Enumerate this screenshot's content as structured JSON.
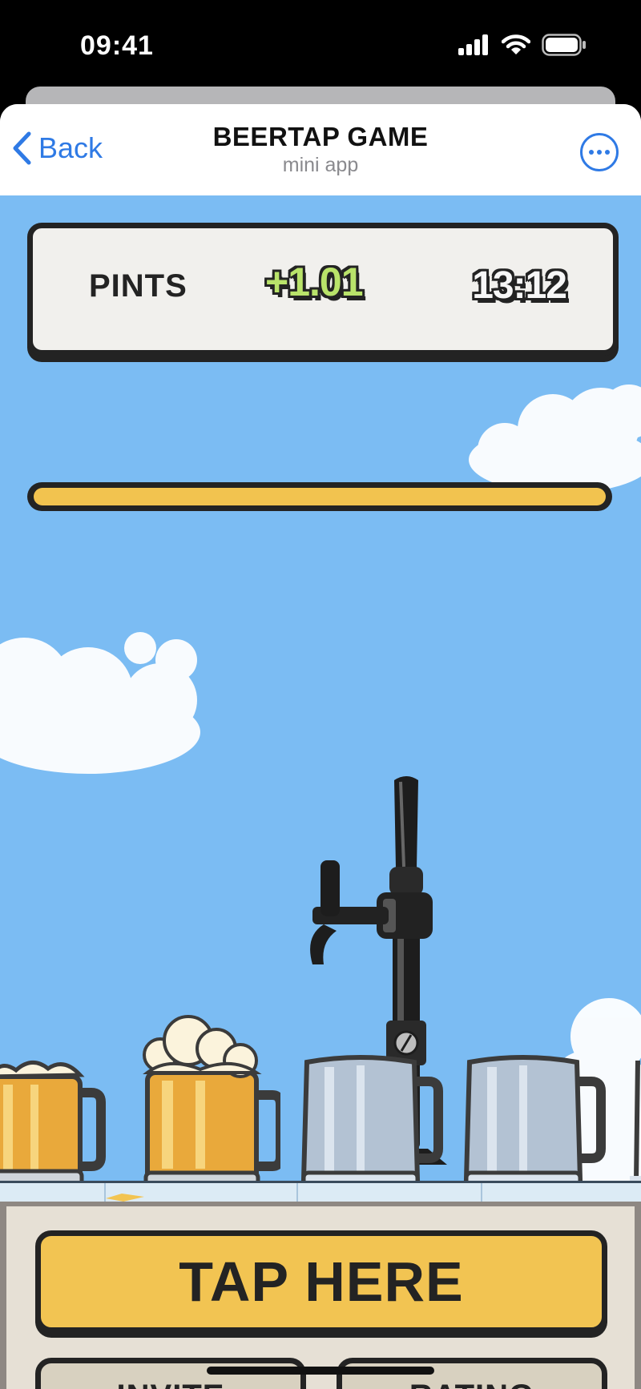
{
  "status_bar": {
    "time": "09:41",
    "icons": [
      "cellular-signal-icon",
      "wifi-icon",
      "battery-icon"
    ]
  },
  "header": {
    "back_label": "Back",
    "title": "BEERTAP GAME",
    "subtitle": "mini app",
    "more_icon": "more-options-icon"
  },
  "game": {
    "score_label": "PINTS",
    "bonus": "+1.01",
    "timer": "13:12",
    "progress_fraction": 1.0,
    "mugs": [
      {
        "state": "full-foam"
      },
      {
        "state": "full-overflowing-foam"
      },
      {
        "state": "empty"
      },
      {
        "state": "empty"
      }
    ]
  },
  "controls": {
    "tap_label": "TAP HERE",
    "invite_label": "INVITE",
    "rating_label": "RATING"
  },
  "colors": {
    "accent_blue": "#2f7ae5",
    "sky": "#7bbcf3",
    "gold": "#f2c452",
    "outline": "#232323",
    "bonus_green": "#b9e36a"
  }
}
